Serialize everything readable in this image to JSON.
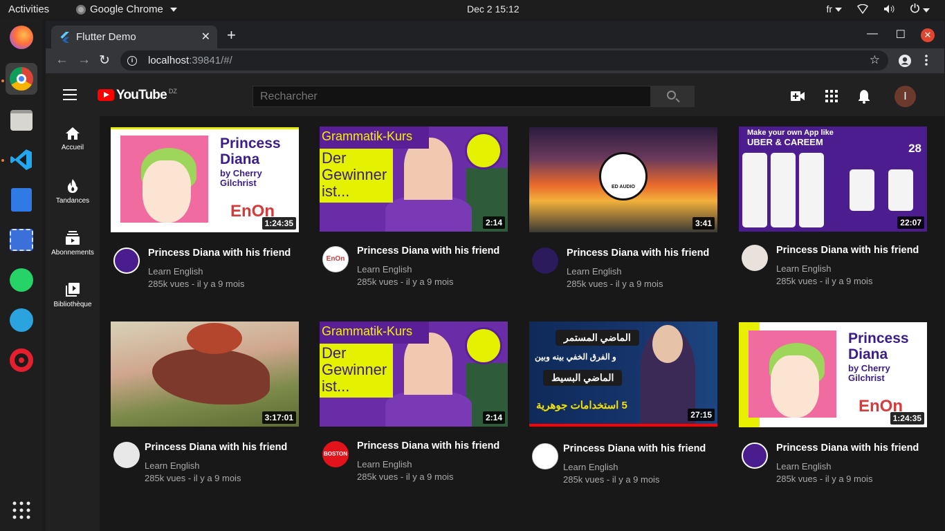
{
  "system": {
    "activities": "Activities",
    "app_name": "Google Chrome",
    "clock": "Dec 2  15:12",
    "lang": "fr"
  },
  "browser": {
    "tab_title": "Flutter Demo",
    "url_host": "localhost",
    "url_rest": ":39841/#/"
  },
  "youtube": {
    "logo_text": "YouTube",
    "country_code": "DZ",
    "search_placeholder": "Recharcher",
    "avatar_letter": "I",
    "nav": [
      {
        "label": "Accueil",
        "icon": "home-icon"
      },
      {
        "label": "Tandances",
        "icon": "fire-icon"
      },
      {
        "label": "Abonnements",
        "icon": "subscriptions-icon"
      },
      {
        "label": "Bibliothèque",
        "icon": "library-icon"
      }
    ],
    "thumb_text": {
      "princess": "Princess",
      "diana": "Diana",
      "by_cherry": "by Cherry",
      "gilchrist": "Gilchrist",
      "enon": "EnOn",
      "grammatik": "Grammatik-Kurs",
      "gewinner": "Der Gewinner ist...",
      "ed_audio": "ED AUDIO",
      "app_title_1": "Make your own App like",
      "app_title_2": "UBER  &  CAREEM",
      "app_num": "28",
      "arabic_1": "الماضي المستمر",
      "arabic_2": "و الفرق الخفي بينه وبين",
      "arabic_3": "الماضي البسيط",
      "arabic_4": "5 استخدامات جوهرية"
    },
    "videos": [
      {
        "title": "Princess Diana with his friend",
        "channel": "Learn English",
        "meta": "285k vues - il y a 9 mois",
        "duration": "1:24:35"
      },
      {
        "title": "Princess Diana with his friend",
        "channel": "Learn English",
        "meta": "285k vues - il y a 9 mois",
        "duration": "2:14"
      },
      {
        "title": "Princess Diana with his friend",
        "channel": "Learn English",
        "meta": "285k vues - il y a 9 mois",
        "duration": "3:41"
      },
      {
        "title": "Princess Diana with his friend",
        "channel": "Learn English",
        "meta": "285k vues - il y a 9 mois",
        "duration": "22:07"
      },
      {
        "title": "Princess Diana with his friend",
        "channel": "Learn English",
        "meta": "285k vues - il y a 9 mois",
        "duration": "3:17:01"
      },
      {
        "title": "Princess Diana with his friend",
        "channel": "Learn English",
        "meta": "285k vues - il y a 9 mois",
        "duration": "2:14"
      },
      {
        "title": "Princess Diana with his friend",
        "channel": "Learn English",
        "meta": "285k vues - il y a 9 mois",
        "duration": "27:15"
      },
      {
        "title": "Princess Diana with his friend",
        "channel": "Learn English",
        "meta": "285k vues - il y a 9 mois",
        "duration": "1:24:35"
      }
    ],
    "channel_badges": {
      "boston": "BOSTON",
      "enon": "EnOn"
    }
  }
}
